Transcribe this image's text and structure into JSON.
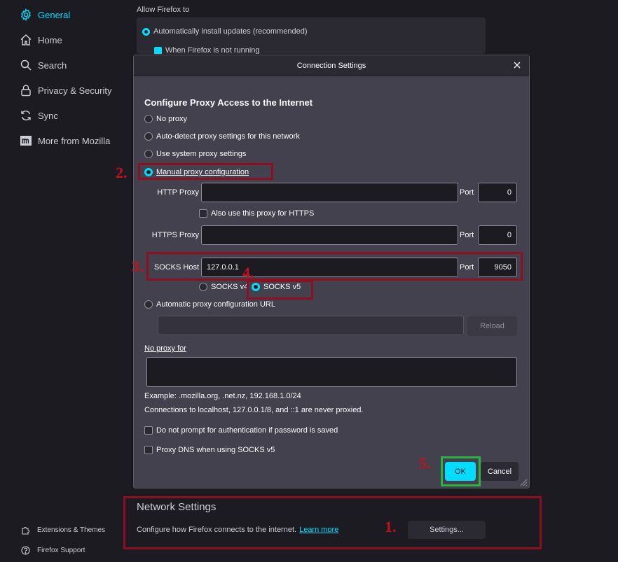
{
  "sidebar": {
    "items": [
      {
        "label": "General",
        "icon": "gear-icon"
      },
      {
        "label": "Home",
        "icon": "home-icon"
      },
      {
        "label": "Search",
        "icon": "search-icon"
      },
      {
        "label": "Privacy & Security",
        "icon": "lock-icon"
      },
      {
        "label": "Sync",
        "icon": "sync-icon"
      },
      {
        "label": "More from Mozilla",
        "icon": "mozilla-icon"
      }
    ],
    "footer": [
      {
        "label": "Extensions & Themes",
        "icon": "puzzle-icon"
      },
      {
        "label": "Firefox Support",
        "icon": "help-icon"
      }
    ]
  },
  "background": {
    "allow_title": "Allow Firefox to",
    "auto_update_label": "Automatically install updates (recommended)",
    "not_running_label": "When Firefox is not running",
    "network_title": "Network Settings",
    "network_desc": "Configure how Firefox connects to the internet.",
    "learn_more": "Learn more",
    "settings_button": "Settings..."
  },
  "dialog": {
    "title": "Connection Settings",
    "section_title": "Configure Proxy Access to the Internet",
    "options": {
      "no_proxy": "No proxy",
      "auto_detect": "Auto-detect proxy settings for this network",
      "system": "Use system proxy settings",
      "manual": "Manual proxy configuration",
      "pac": "Automatic proxy configuration URL"
    },
    "http_proxy_label": "HTTP Proxy",
    "http_proxy_value": "",
    "http_port_label": "Port",
    "http_port_value": "0",
    "also_https_label": "Also use this proxy for HTTPS",
    "https_proxy_label": "HTTPS Proxy",
    "https_proxy_value": "",
    "https_port_label": "Port",
    "https_port_value": "0",
    "socks_host_label": "SOCKS Host",
    "socks_host_value": "127.0.0.1",
    "socks_port_label": "Port",
    "socks_port_value": "9050",
    "socks_v4": "SOCKS v4",
    "socks_v5": "SOCKS v5",
    "pac_url_value": "",
    "reload_button": "Reload",
    "no_proxy_for_label": "No proxy for",
    "no_proxy_for_value": "",
    "example_text": "Example: .mozilla.org, .net.nz, 192.168.1.0/24",
    "localhost_text": "Connections to localhost, 127.0.0.1/8, and ::1 are never proxied.",
    "no_auth_prompt": "Do not prompt for authentication if password is saved",
    "proxy_dns": "Proxy DNS when using SOCKS v5",
    "ok_button": "OK",
    "cancel_button": "Cancel"
  },
  "annotations": {
    "step1": "1.",
    "step2": "2.",
    "step3": "3.",
    "step4": "4.",
    "step5": "5."
  },
  "colors": {
    "accent": "#00ddff",
    "annotation_red": "#8e1020",
    "annotation_green": "#2db341"
  }
}
